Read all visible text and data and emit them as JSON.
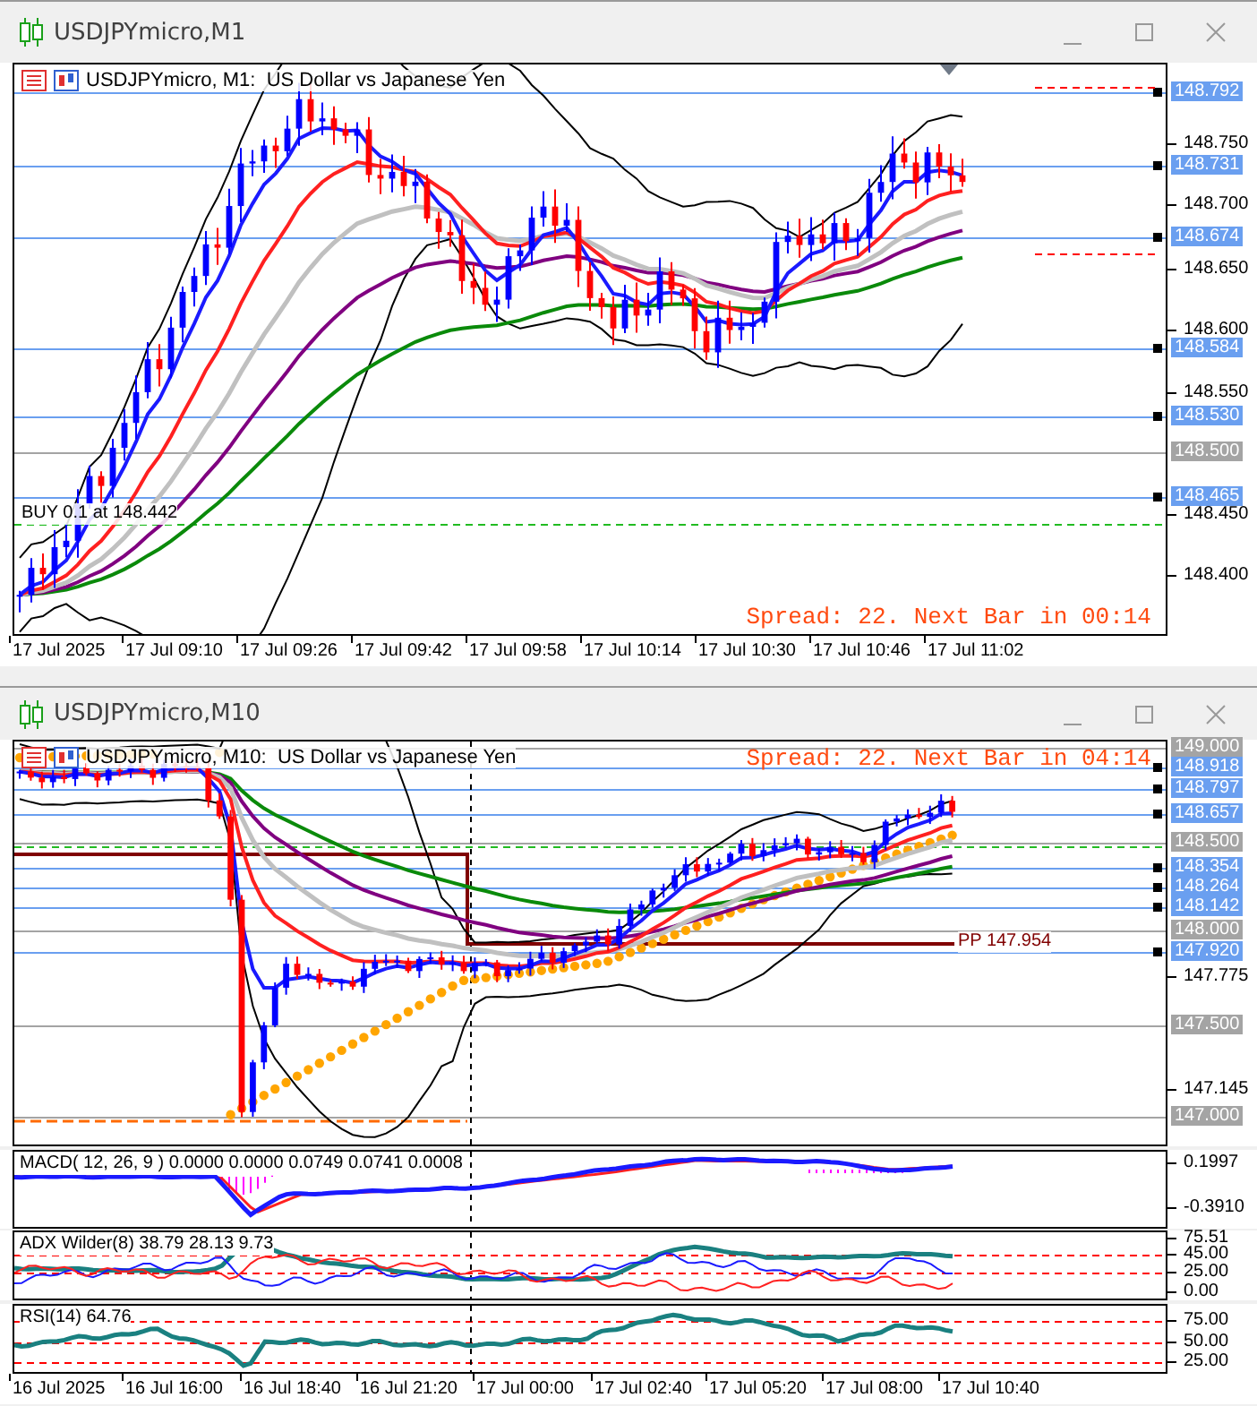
{
  "windows": [
    {
      "title": "USDJPYmicro,M1",
      "chart_label": "USDJPYmicro, M1:  US Dollar vs Japanese Yen",
      "status": "Spread: 22. Next Bar in 00:14",
      "order_label": "BUY 0.1 at 148.442",
      "panes": [
        {
          "kind": "price",
          "axis": [
            {
              "text": "148.792",
              "kind": "line"
            },
            {
              "text": "148.750",
              "kind": "tick"
            },
            {
              "text": "148.731",
              "kind": "line"
            },
            {
              "text": "148.700",
              "kind": "tick"
            },
            {
              "text": "148.674",
              "kind": "line"
            },
            {
              "text": "148.650",
              "kind": "tick"
            },
            {
              "text": "148.600",
              "kind": "tick"
            },
            {
              "text": "148.584",
              "kind": "line"
            },
            {
              "text": "148.550",
              "kind": "tick"
            },
            {
              "text": "148.530",
              "kind": "line"
            },
            {
              "text": "148.500",
              "kind": "level"
            },
            {
              "text": "148.465",
              "kind": "line"
            },
            {
              "text": "148.450",
              "kind": "tick"
            },
            {
              "text": "148.400",
              "kind": "tick"
            }
          ]
        }
      ],
      "time_axis": [
        "17 Jul 2025",
        "17 Jul 09:10",
        "17 Jul 09:26",
        "17 Jul 09:42",
        "17 Jul 09:58",
        "17 Jul 10:14",
        "17 Jul 10:30",
        "17 Jul 10:46",
        "17 Jul 11:02"
      ]
    },
    {
      "title": "USDJPYmicro,M10",
      "chart_label": "USDJPYmicro, M10:  US Dollar vs Japanese Yen",
      "status": "Spread: 22. Next Bar in 04:14",
      "pivot_label": "PP 147.954",
      "panes": [
        {
          "kind": "price",
          "axis": [
            {
              "text": "149.000",
              "kind": "level"
            },
            {
              "text": "148.918",
              "kind": "line"
            },
            {
              "text": "148.797",
              "kind": "line"
            },
            {
              "text": "148.657",
              "kind": "line"
            },
            {
              "text": "148.500",
              "kind": "level"
            },
            {
              "text": "148.354",
              "kind": "line"
            },
            {
              "text": "148.264",
              "kind": "line"
            },
            {
              "text": "148.142",
              "kind": "line"
            },
            {
              "text": "148.000",
              "kind": "level"
            },
            {
              "text": "147.920",
              "kind": "line"
            },
            {
              "text": "147.775",
              "kind": "tick"
            },
            {
              "text": "147.500",
              "kind": "level"
            },
            {
              "text": "147.145",
              "kind": "tick"
            },
            {
              "text": "147.000",
              "kind": "level"
            }
          ]
        },
        {
          "kind": "macd",
          "label": "MACD( 12, 26, 9 ) 0.0000 0.0000 0.0749 0.0741 0.0008",
          "axis": [
            {
              "text": "0.1997",
              "kind": "tick"
            },
            {
              "text": "-0.3910",
              "kind": "tick"
            }
          ]
        },
        {
          "kind": "adx",
          "label": "ADX Wilder(8) 38.79 28.13 9.73",
          "axis": [
            {
              "text": "75.51",
              "kind": "tick"
            },
            {
              "text": "45.00",
              "kind": "tick"
            },
            {
              "text": "25.00",
              "kind": "tick"
            },
            {
              "text": "0.00",
              "kind": "tick"
            }
          ]
        },
        {
          "kind": "rsi",
          "label": "RSI(14) 64.76",
          "axis": [
            {
              "text": "75.00",
              "kind": "tick"
            },
            {
              "text": "50.00",
              "kind": "tick"
            },
            {
              "text": "25.00",
              "kind": "tick"
            }
          ]
        }
      ],
      "time_axis": [
        "16 Jul 2025",
        "16 Jul 16:00",
        "16 Jul 18:40",
        "16 Jul 21:20",
        "17 Jul 00:00",
        "17 Jul 02:40",
        "17 Jul 05:20",
        "17 Jul 08:00",
        "17 Jul 10:40"
      ]
    }
  ]
}
